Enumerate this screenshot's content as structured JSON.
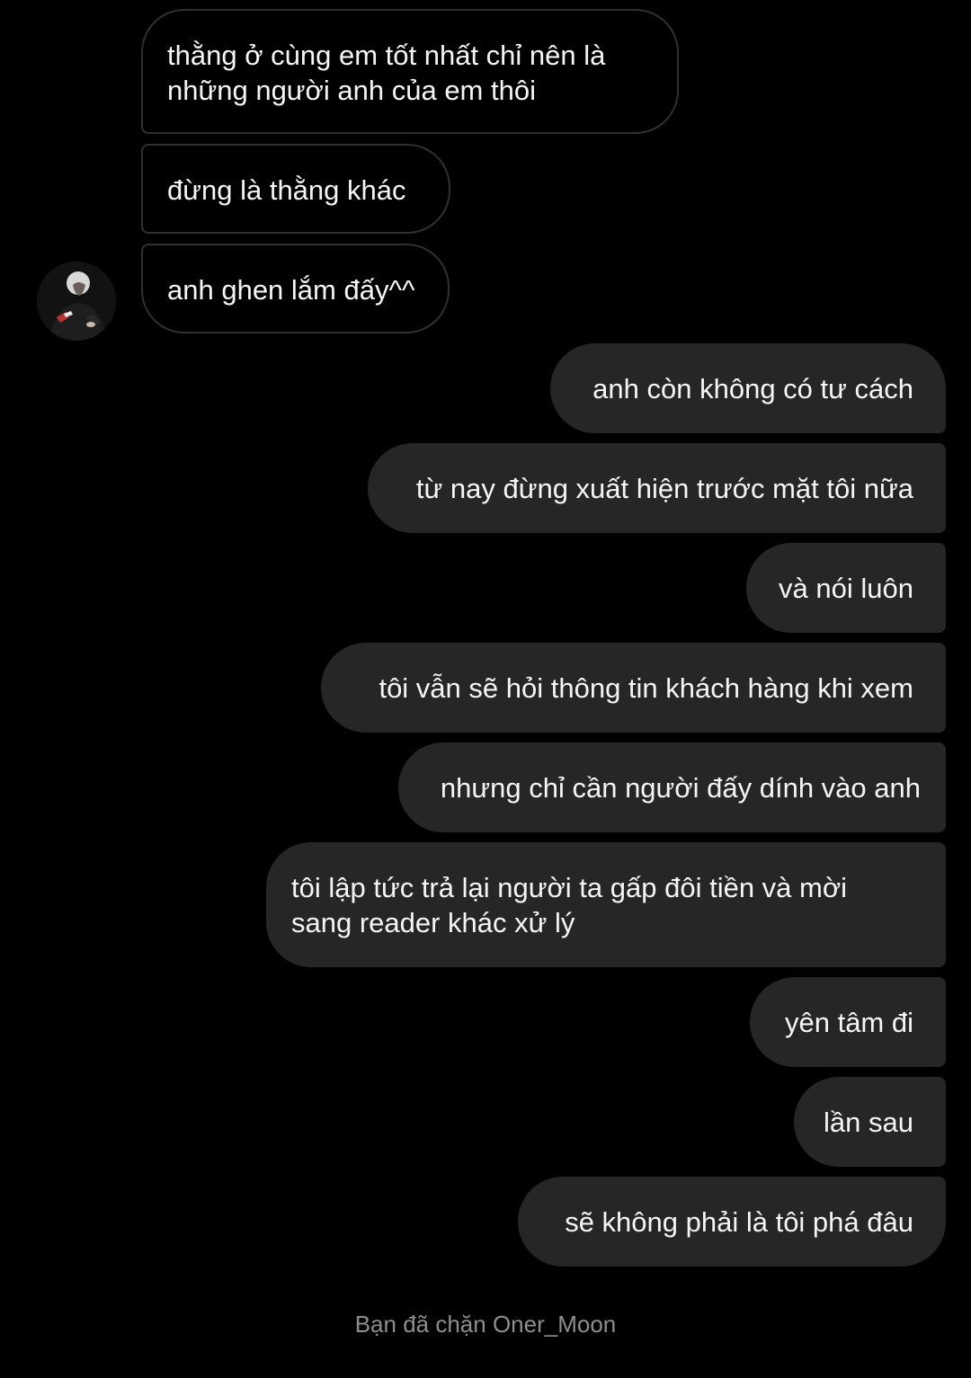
{
  "conversation": {
    "contact_avatar_icon": "user-avatar-photo",
    "incoming": [
      {
        "lines": [
          "thằng ở cùng em tốt nhất chỉ nên là",
          "những người anh của em thôi"
        ]
      },
      {
        "lines": [
          "đừng là thằng khác"
        ]
      },
      {
        "lines": [
          "anh ghen lắm đấy^^"
        ]
      }
    ],
    "outgoing": [
      {
        "lines": [
          "anh còn không có tư cách"
        ]
      },
      {
        "lines": [
          "từ nay đừng xuất hiện trước mặt tôi nữa"
        ]
      },
      {
        "lines": [
          "và nói luôn"
        ]
      },
      {
        "lines": [
          "tôi vẫn sẽ hỏi thông tin khách hàng khi xem"
        ]
      },
      {
        "lines": [
          "nhưng chỉ cần người đấy dính vào anh"
        ]
      },
      {
        "lines": [
          "tôi lập tức trả lại người ta gấp đôi tiền và mời",
          "sang reader khác xử lý"
        ]
      },
      {
        "lines": [
          "yên tâm đi"
        ]
      },
      {
        "lines": [
          "lần sau"
        ]
      },
      {
        "lines": [
          "sẽ không phải là tôi phá đâu"
        ]
      }
    ],
    "blocked_notice": "Bạn đã chặn Oner_Moon"
  },
  "colors": {
    "background": "#000000",
    "incoming_border": "#303030",
    "outgoing_fill": "#262626",
    "text": "#f5f5f5",
    "notice_text": "#8e8e8e"
  }
}
